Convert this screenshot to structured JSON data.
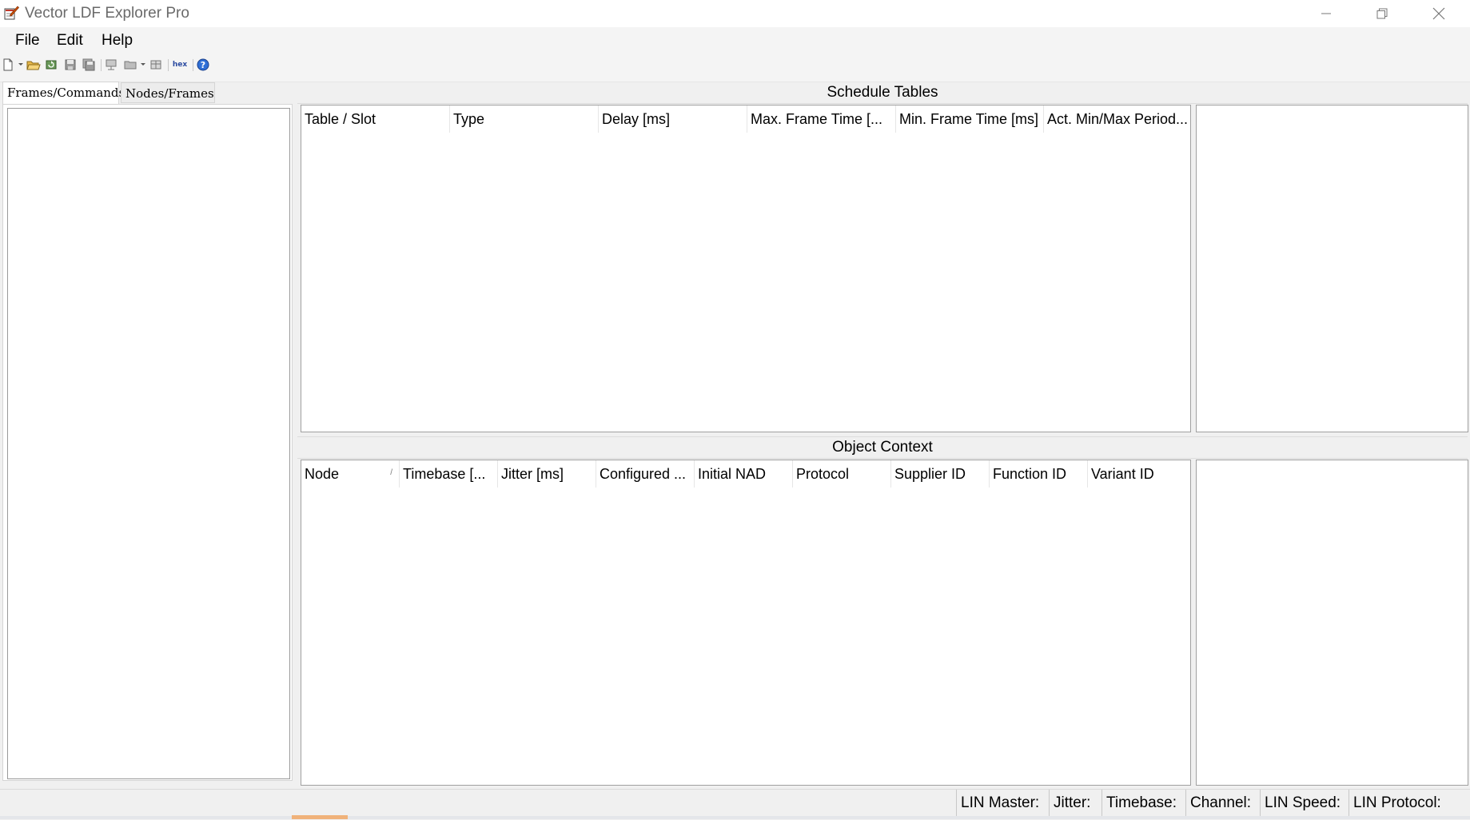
{
  "window": {
    "title": "Vector LDF Explorer Pro"
  },
  "menu": {
    "file": "File",
    "edit": "Edit",
    "help": "Help"
  },
  "toolbar": {
    "icons": [
      "new-icon",
      "open-icon",
      "reload-icon",
      "save-icon",
      "save-all-icon",
      "export-icon",
      "folder-icon",
      "grid-icon",
      "hex-icon",
      "help-icon"
    ],
    "hex_label": "hex"
  },
  "left_panel": {
    "tabs": [
      "Frames/Commands",
      "Nodes/Frames"
    ]
  },
  "schedule": {
    "title": "Schedule Tables",
    "columns": [
      "Table / Slot",
      "Type",
      "Delay [ms]",
      "Max. Frame Time [...",
      "Min. Frame Time [ms]",
      "Act. Min/Max Period..."
    ]
  },
  "object_context": {
    "title": "Object Context",
    "columns": [
      "Node",
      "Timebase [...",
      "Jitter [ms]",
      "Configured ...",
      "Initial NAD",
      "Protocol",
      "Supplier ID",
      "Function ID",
      "Variant ID"
    ]
  },
  "statusbar": {
    "items": [
      "LIN Master:",
      "Jitter:",
      "Timebase:",
      "Channel:",
      "LIN Speed:",
      "LIN Protocol:"
    ]
  }
}
